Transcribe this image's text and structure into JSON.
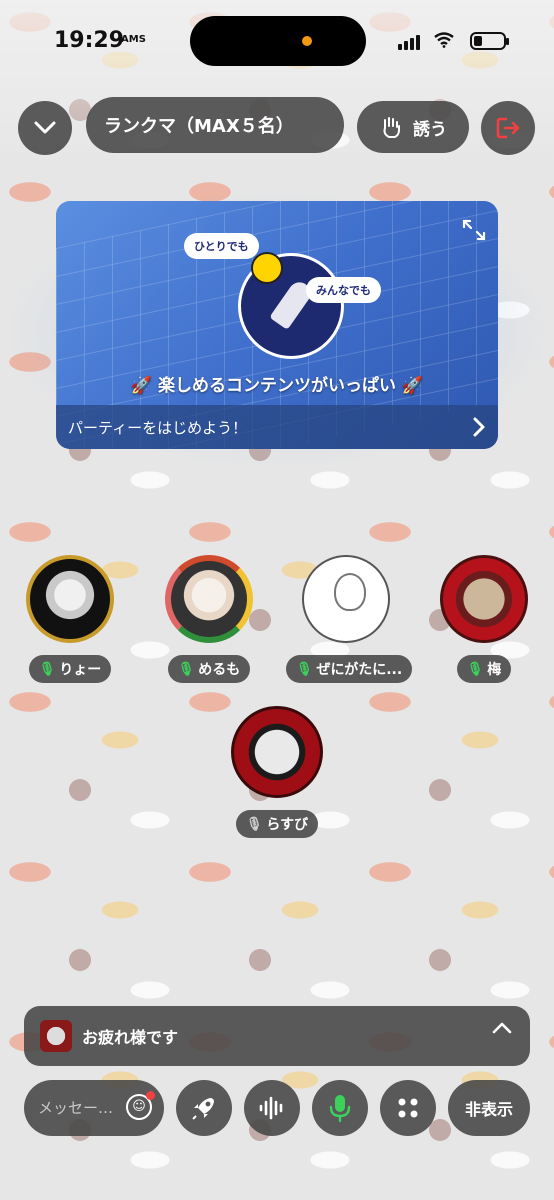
{
  "status_bar": {
    "time": "19:29",
    "carrier_tag": "AMS"
  },
  "header": {
    "room_title": "ランクマ（MAX５名）",
    "invite_label": "誘う"
  },
  "banner": {
    "bubble_1": "ひとりでも",
    "bubble_2": "みんなでも",
    "caption": "楽しめるコンテンツがいっぱい",
    "footer": "パーティーをはじめよう！"
  },
  "participants": [
    {
      "name": "りょー",
      "mic": "on"
    },
    {
      "name": "めるも",
      "mic": "on"
    },
    {
      "name": "ぜにがたに...",
      "mic": "on"
    },
    {
      "name": "梅",
      "mic": "on"
    },
    {
      "name": "らすび",
      "mic": "off"
    }
  ],
  "chat": {
    "latest_message": "お疲れ様です"
  },
  "bottom_bar": {
    "message_placeholder": "メッセー…",
    "hide_label": "非表示"
  },
  "colors": {
    "mic_on": "#3bd15b",
    "exit": "#f04040",
    "banner": "#3f6fcc"
  }
}
